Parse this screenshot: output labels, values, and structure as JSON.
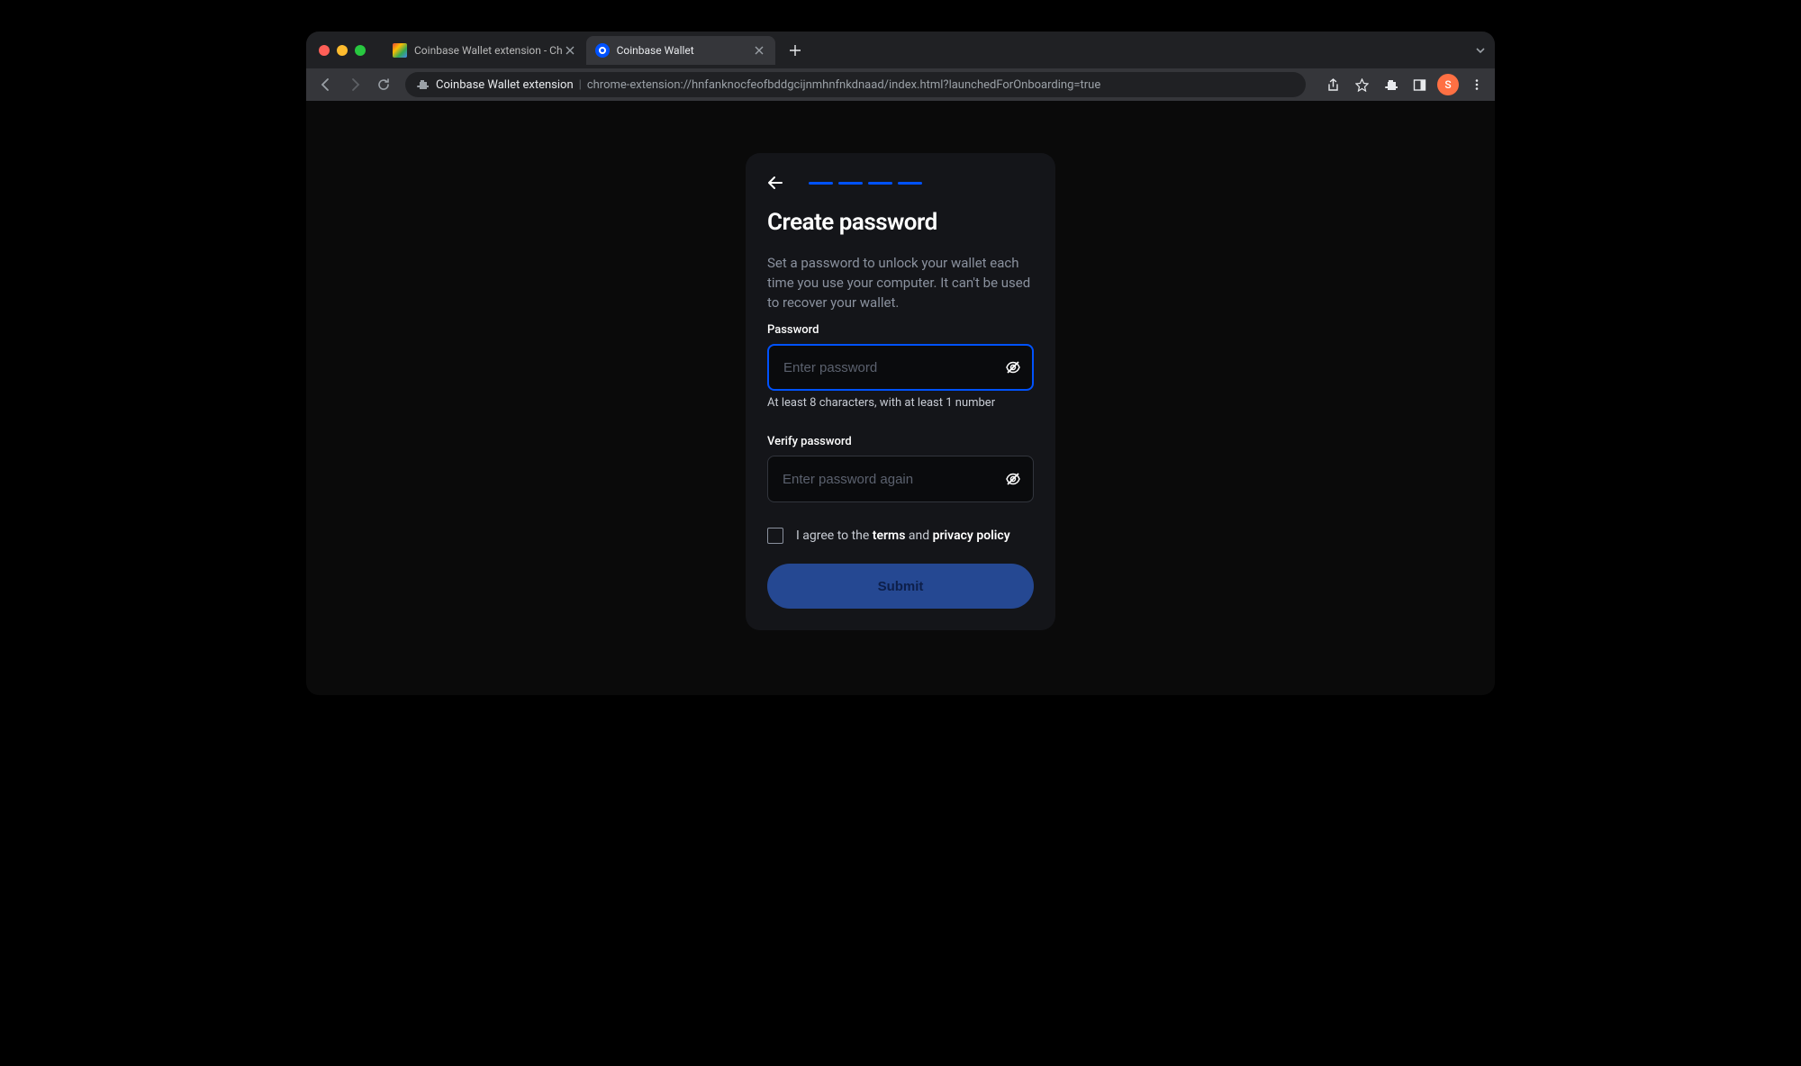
{
  "browser": {
    "tabs": [
      {
        "title": "Coinbase Wallet extension - Ch",
        "active": false
      },
      {
        "title": "Coinbase Wallet",
        "active": true
      }
    ],
    "url_label": "Coinbase Wallet extension",
    "url_path": "chrome-extension://hnfanknocfeofbddgcijnmhnfnkdnaad/index.html?launchedForOnboarding=true",
    "avatar_letter": "S"
  },
  "card": {
    "title": "Create password",
    "description": "Set a password to unlock your wallet each time you use your computer. It can't be used to recover your wallet.",
    "password_label": "Password",
    "password_placeholder": "Enter password",
    "password_hint": "At least 8 characters, with at least 1 number",
    "verify_label": "Verify password",
    "verify_placeholder": "Enter password again",
    "agree_prefix": "I agree to the ",
    "terms_text": "terms",
    "agree_mid": " and ",
    "privacy_text": "privacy policy",
    "submit_label": "Submit",
    "progress_steps": 4
  }
}
